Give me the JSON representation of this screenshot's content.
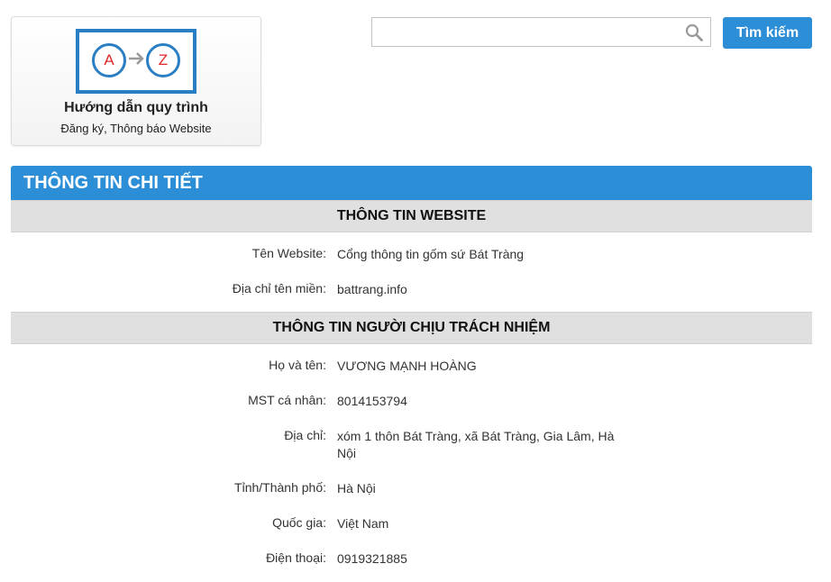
{
  "guide": {
    "letter_a": "A",
    "letter_z": "Z",
    "title": "Hướng dẫn quy trình",
    "subtitle": "Đăng ký, Thông báo Website"
  },
  "search": {
    "value": "",
    "placeholder": "",
    "button_label": "Tìm kiếm",
    "icon": "search-icon"
  },
  "panel": {
    "title": "THÔNG TIN CHI TIẾT",
    "website_section": {
      "title": "THÔNG TIN WEBSITE",
      "rows": [
        {
          "label": "Tên Website:",
          "value": "Cổng thông tin gốm sứ Bát Tràng"
        },
        {
          "label": "Địa chỉ tên miền:",
          "value": "battrang.info"
        }
      ]
    },
    "owner_section": {
      "title": "THÔNG TIN NGƯỜI CHỊU TRÁCH NHIỆM",
      "rows": [
        {
          "label": "Họ và tên:",
          "value": "VƯƠNG MẠNH HOÀNG"
        },
        {
          "label": "MST cá nhân:",
          "value": "8014153794"
        },
        {
          "label": "Địa chỉ:",
          "value": "xóm 1 thôn Bát Tràng, xã Bát Tràng, Gia Lâm, Hà Nội"
        },
        {
          "label": "Tỉnh/Thành phố:",
          "value": "Hà Nội"
        },
        {
          "label": "Quốc gia:",
          "value": "Việt Nam"
        },
        {
          "label": "Điện thoại:",
          "value": "0919321885"
        }
      ]
    }
  },
  "colors": {
    "accent": "#2d8ed8",
    "section_bg": "#e0e0e0",
    "az_border": "#2a7fc4",
    "az_letter": "#e02828"
  }
}
